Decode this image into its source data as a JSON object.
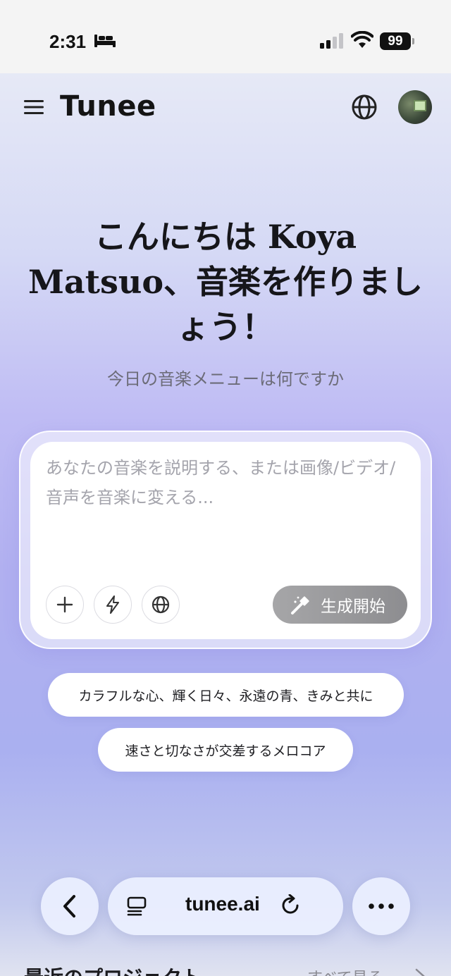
{
  "status_bar": {
    "time": "2:31",
    "battery": "99",
    "icons": [
      "bed-icon",
      "signal-icon",
      "wifi-icon",
      "battery-icon"
    ]
  },
  "header": {
    "brand": "Tunee",
    "icons": [
      "menu-icon",
      "globe-icon",
      "avatar"
    ]
  },
  "hero": {
    "headline": "こんにちは Koya Matsuo、音楽を作りましょう！",
    "subtitle": "今日の音楽メニューは何ですか"
  },
  "prompt": {
    "placeholder": "あなたの音楽を説明する、または画像/ビデオ/音声を音楽に変える...",
    "value": "",
    "tools": [
      "plus-icon",
      "lightning-icon",
      "globe-icon"
    ],
    "generate_label": "生成開始"
  },
  "suggestions": [
    "カラフルな心、輝く日々、永遠の青、きみと共に",
    "速さと切なさが交差するメロコア"
  ],
  "browser": {
    "url": "tunee.ai",
    "icons": [
      "back-icon",
      "tabs-icon",
      "reload-icon",
      "more-icon"
    ]
  },
  "recent": {
    "title": "最近のプロジェクト",
    "see_all": "すべて見る"
  },
  "colors": {
    "gradient_top": "#e6e9f6",
    "gradient_mid": "#b1b0f0",
    "generate_button": "#9a9a9c",
    "text_primary": "#16161a",
    "text_secondary": "#6c6c78"
  }
}
